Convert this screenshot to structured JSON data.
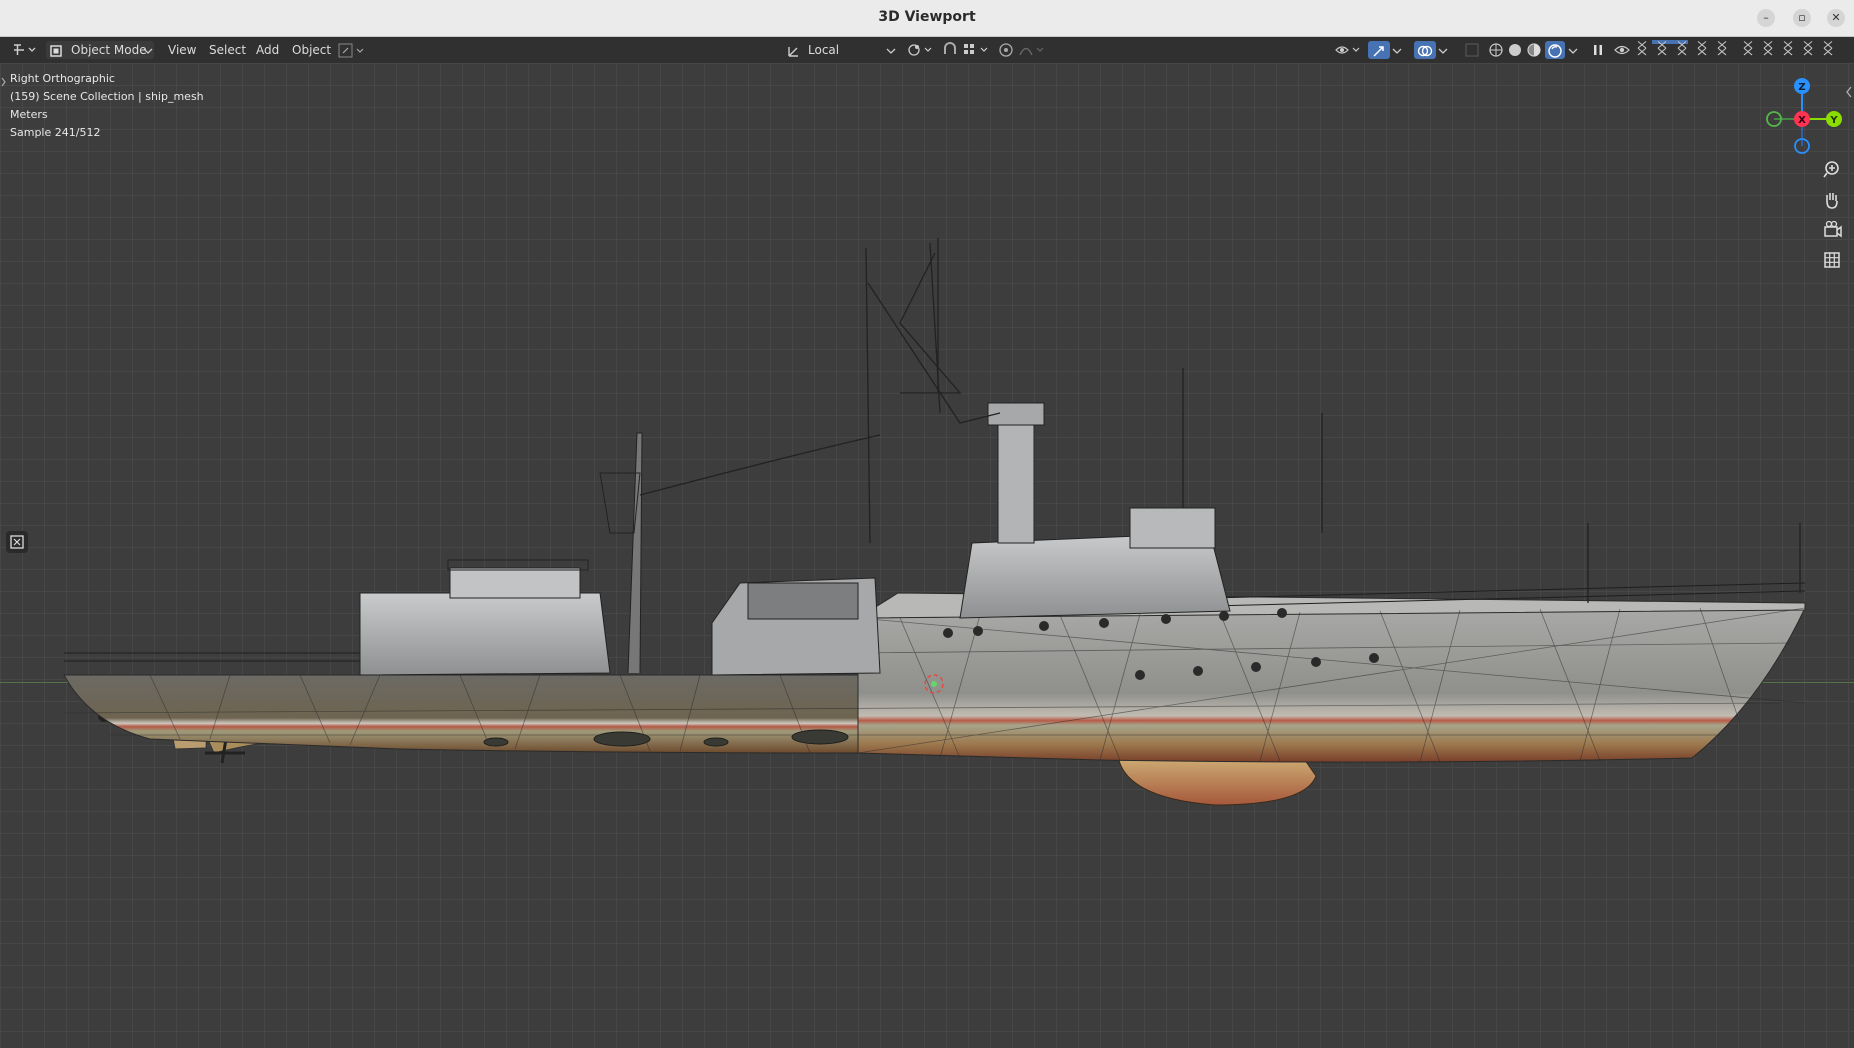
{
  "window": {
    "title": "3D Viewport"
  },
  "header": {
    "mode_label": "Object Mode",
    "menus": [
      "View",
      "Select",
      "Add",
      "Object"
    ],
    "orientation_label": "Local"
  },
  "overlay": {
    "view_name": "Right Orthographic",
    "collection": "(159) Scene Collection | ship_mesh",
    "units": "Meters",
    "sample": "Sample 241/512"
  },
  "gizmo": {
    "z": "Z",
    "x": "X",
    "y": "Y"
  },
  "colors": {
    "accent": "#4772b3",
    "axis_x": "#ff3352",
    "axis_y": "#8bdc00",
    "axis_z": "#2890ff"
  }
}
